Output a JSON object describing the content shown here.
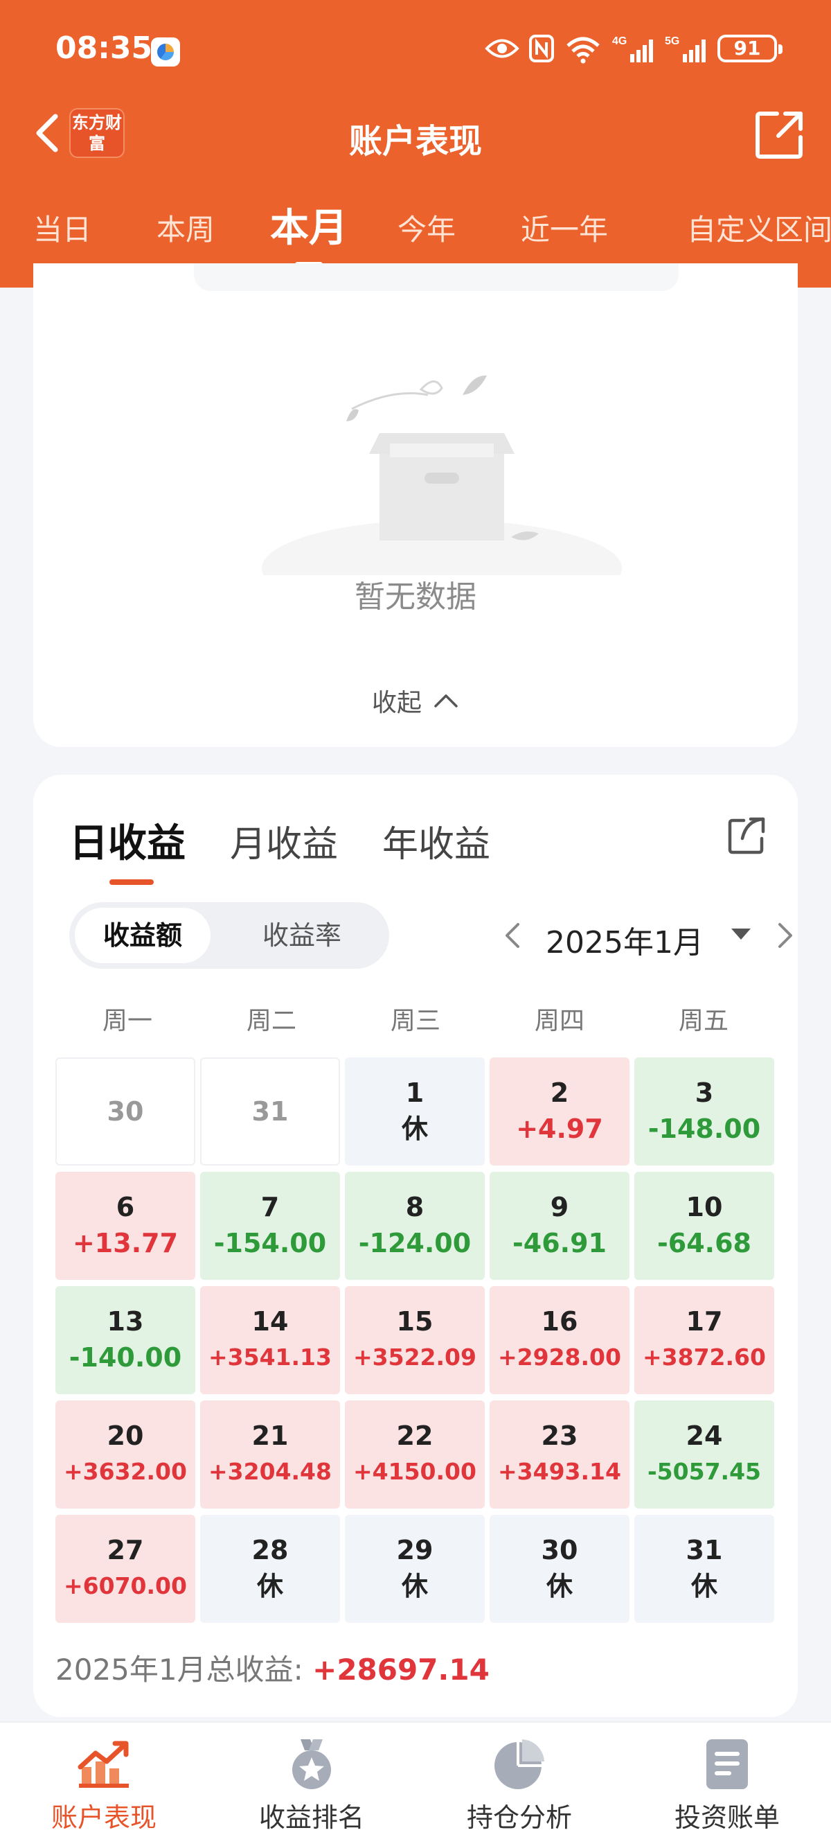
{
  "status_bar": {
    "time": "08:35",
    "network1": "4G",
    "network2": "5G",
    "battery": "91"
  },
  "nav": {
    "logo": "东方财富",
    "title": "账户表现"
  },
  "range_tabs": [
    "当日",
    "本周",
    "本月",
    "今年",
    "近一年",
    "自定义区间"
  ],
  "range_active": "本月",
  "empty": {
    "text": "暂无数据",
    "collapse_label": "收起"
  },
  "profit": {
    "tabs": [
      "日收益",
      "月收益",
      "年收益"
    ],
    "active_tab": "日收益",
    "toggle": [
      "收益额",
      "收益率"
    ],
    "month": "2025年1月",
    "weekdays": [
      "周一",
      "周二",
      "周三",
      "周四",
      "周五"
    ],
    "days": [
      {
        "d": "30",
        "v": "",
        "t": "other"
      },
      {
        "d": "31",
        "v": "",
        "t": "other"
      },
      {
        "d": "1",
        "v": "休",
        "t": "rest"
      },
      {
        "d": "2",
        "v": "+4.97",
        "t": "up"
      },
      {
        "d": "3",
        "v": "-148.00",
        "t": "down"
      },
      {
        "d": "6",
        "v": "+13.77",
        "t": "up"
      },
      {
        "d": "7",
        "v": "-154.00",
        "t": "down"
      },
      {
        "d": "8",
        "v": "-124.00",
        "t": "down"
      },
      {
        "d": "9",
        "v": "-46.91",
        "t": "down"
      },
      {
        "d": "10",
        "v": "-64.68",
        "t": "down"
      },
      {
        "d": "13",
        "v": "-140.00",
        "t": "down"
      },
      {
        "d": "14",
        "v": "+3541.13",
        "t": "up"
      },
      {
        "d": "15",
        "v": "+3522.09",
        "t": "up"
      },
      {
        "d": "16",
        "v": "+2928.00",
        "t": "up"
      },
      {
        "d": "17",
        "v": "+3872.60",
        "t": "up"
      },
      {
        "d": "20",
        "v": "+3632.00",
        "t": "up"
      },
      {
        "d": "21",
        "v": "+3204.48",
        "t": "up"
      },
      {
        "d": "22",
        "v": "+4150.00",
        "t": "up"
      },
      {
        "d": "23",
        "v": "+3493.14",
        "t": "up"
      },
      {
        "d": "24",
        "v": "-5057.45",
        "t": "down"
      },
      {
        "d": "27",
        "v": "+6070.00",
        "t": "up"
      },
      {
        "d": "28",
        "v": "休",
        "t": "rest"
      },
      {
        "d": "29",
        "v": "休",
        "t": "rest"
      },
      {
        "d": "30",
        "v": "休",
        "t": "rest"
      },
      {
        "d": "31",
        "v": "休",
        "t": "rest"
      }
    ],
    "total_label": "2025年1月总收益:",
    "total_value": "+28697.14"
  },
  "bottom_nav": {
    "items": [
      "账户表现",
      "收益排名",
      "持仓分析",
      "投资账单"
    ],
    "active": "账户表现"
  },
  "colors": {
    "brand": "#ec622c",
    "up": "#e0353b",
    "down": "#2e9a3a"
  }
}
